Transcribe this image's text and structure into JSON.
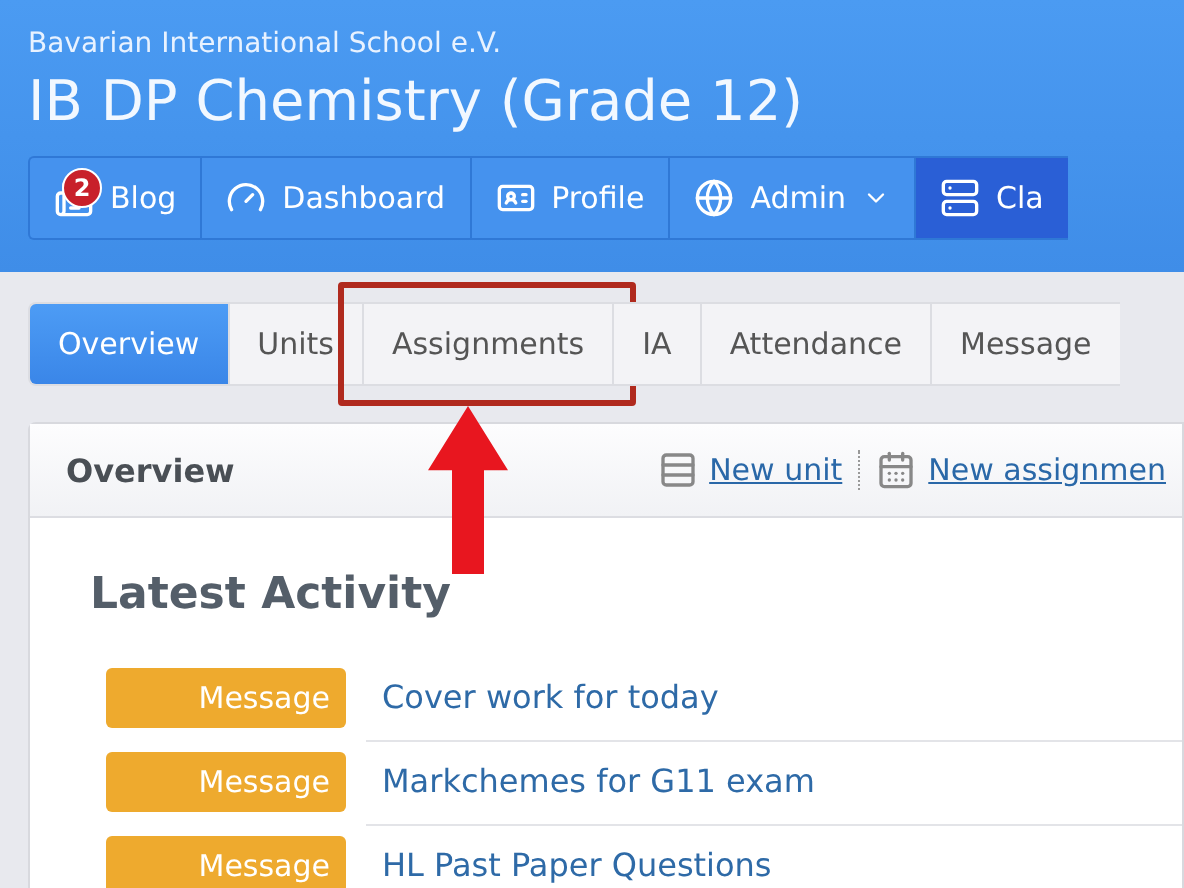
{
  "header": {
    "school": "Bavarian International School e.V.",
    "title": "IB DP Chemistry (Grade 12)"
  },
  "nav": [
    {
      "label": "Blog",
      "kind": "news",
      "badge": "2",
      "caret": false,
      "selected": false
    },
    {
      "label": "Dashboard",
      "kind": "gauge",
      "caret": false,
      "selected": false
    },
    {
      "label": "Profile",
      "kind": "card",
      "caret": false,
      "selected": false
    },
    {
      "label": "Admin",
      "kind": "globe",
      "caret": true,
      "selected": false
    },
    {
      "label": "Cla",
      "kind": "server",
      "caret": false,
      "selected": true
    }
  ],
  "tabs": [
    {
      "label": "Overview",
      "selected": true,
      "highlighted": false
    },
    {
      "label": "Units",
      "selected": false,
      "highlighted": false
    },
    {
      "label": "Assignments",
      "selected": false,
      "highlighted": true
    },
    {
      "label": "IA",
      "selected": false,
      "highlighted": false
    },
    {
      "label": "Attendance",
      "selected": false,
      "highlighted": false
    },
    {
      "label": "Message",
      "selected": false,
      "highlighted": false
    }
  ],
  "card": {
    "title": "Overview",
    "actions": [
      {
        "label": "New unit",
        "kind": "list"
      },
      {
        "label": "New assignmen",
        "kind": "calendar"
      }
    ],
    "section_title": "Latest Activity",
    "activity": [
      {
        "tag": "Message",
        "title": "Cover work for today"
      },
      {
        "tag": "Message",
        "title": "Markchemes for G11 exam"
      },
      {
        "tag": "Message",
        "title": "HL Past Paper Questions"
      }
    ]
  }
}
